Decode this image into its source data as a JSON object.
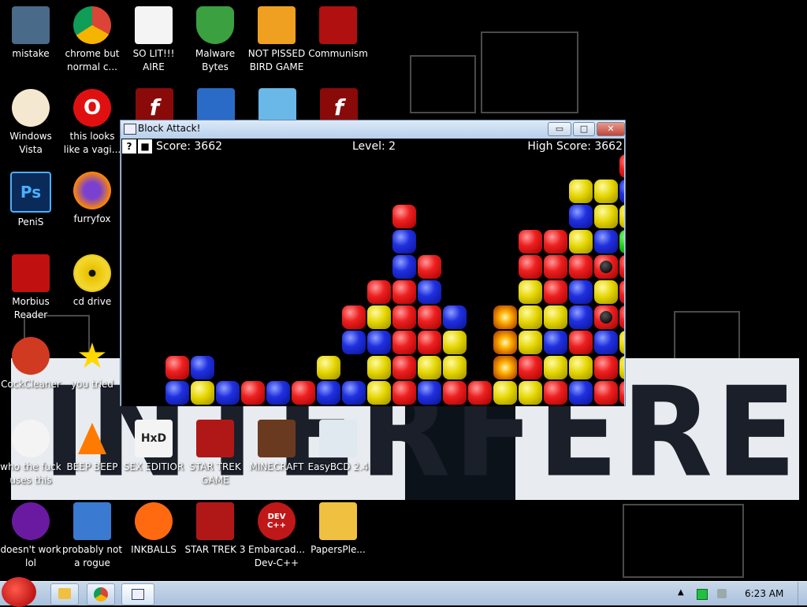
{
  "desktop": {
    "banner_text": "INTERFERENCE",
    "icons": [
      {
        "label": "mistake",
        "icon": "computer-icon"
      },
      {
        "label": "chrome but normal c...",
        "icon": "chrome-icon"
      },
      {
        "label": "SO LIT!!! AIRE",
        "icon": "cards-icon"
      },
      {
        "label": "Malware Bytes",
        "icon": "shield-icon"
      },
      {
        "label": "NOT PISSED BIRD GAME",
        "icon": "pig-icon"
      },
      {
        "label": "Communism",
        "icon": "flag-icon"
      },
      {
        "label": "Windows Vista",
        "icon": "egg-icon"
      },
      {
        "label": "this looks like a vagi...",
        "icon": "opera-icon"
      },
      {
        "label": "PeniS",
        "icon": "photoshop-icon"
      },
      {
        "label": "furryfox",
        "icon": "firefox-icon"
      },
      {
        "label": "Morbius Reader",
        "icon": "pdf-icon"
      },
      {
        "label": "cd drive",
        "icon": "cd-icon"
      },
      {
        "label": "CockCleaner",
        "icon": "cleaner-icon"
      },
      {
        "label": "you tried",
        "icon": "star-icon"
      },
      {
        "label": "who the fuck uses this",
        "icon": "lightning-icon"
      },
      {
        "label": "BEEP BEEP",
        "icon": "vlc-icon"
      },
      {
        "label": "SEX EDITIOR",
        "icon": "hxd-icon"
      },
      {
        "label": "STAR TREK GAME",
        "icon": "startrek-icon"
      },
      {
        "label": "MINECRAFT",
        "icon": "minecraft-icon"
      },
      {
        "label": "EasyBCD 2.4",
        "icon": "easybcd-icon"
      },
      {
        "label": "doesn't work lol",
        "icon": "yahoo-icon"
      },
      {
        "label": "probably not a rogue",
        "icon": "gears-icon"
      },
      {
        "label": "INKBALLS",
        "icon": "inkball-icon"
      },
      {
        "label": "STAR TREK 3",
        "icon": "startrek-icon"
      },
      {
        "label": "Embarcad... Dev-C++",
        "icon": "devcpp-icon"
      },
      {
        "label": "PapersPle...",
        "icon": "folder-icon"
      }
    ],
    "icon_text": {
      "flash": "f",
      "photoshop": "Ps",
      "opera": "O",
      "devcpp": "DEV C++",
      "hxd": "HxD"
    }
  },
  "window": {
    "title": "Block Attack!",
    "minimize": "▭",
    "maximize": "□",
    "close": "✕",
    "help_button": "?",
    "stop_button": "■",
    "score": "Score: 3662",
    "level": "Level: 2",
    "high_score": "High Score: 3662"
  },
  "board": {
    "colors": {
      "R": "#ee2020",
      "B": "#2030e0",
      "Y": "#e4d500",
      "G": "#20d020",
      "F": "#ffb000"
    },
    "rows": [
      "...................R",
      ".................YYBG",
      "..........R......BYYB",
      "..........B....RRYBGY",
      "..........BR...RRRRRRY",
      ".........RRB...YRBYRY",
      "........RYRRB.FYYBRRB",
      "........BBRRY.FYBRBYR",
      ".RB....Y.YRYY.FRYYRYR",
      ".BYBRBRBBYRBRRYYRBRRB"
    ],
    "bomb_cells": [
      "4-18",
      "6-18"
    ]
  },
  "taskbar": {
    "clock": "6:23 AM",
    "tray_up": "▲"
  }
}
